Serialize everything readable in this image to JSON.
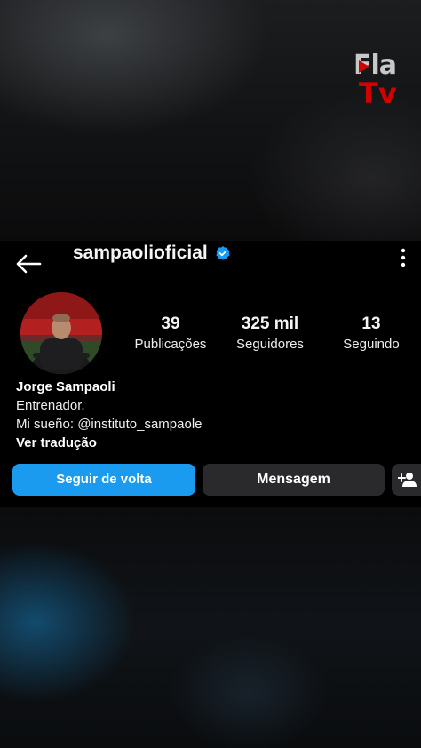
{
  "watermark": {
    "line1": "Fla",
    "line2": "Tv",
    "colors": {
      "line1": "#c8c8c8",
      "line2": "#d40000"
    }
  },
  "header": {
    "back_icon": "arrow-left-icon",
    "username": "sampaolioficial",
    "verified_icon": "verified-badge-icon",
    "more_icon": "more-vertical-icon"
  },
  "profile": {
    "avatar": "profile-photo",
    "stats": [
      {
        "value": "39",
        "label": "Publicações"
      },
      {
        "value": "325 mil",
        "label": "Seguidores"
      },
      {
        "value": "13",
        "label": "Seguindo"
      }
    ],
    "name": "Jorge Sampaoli",
    "bio_lines": [
      "Entrenador.",
      "Mi sueño: @instituto_sampaole"
    ],
    "translate_link": "Ver tradução"
  },
  "actions": {
    "follow_back_label": "Seguir de volta",
    "message_label": "Mensagem",
    "add_person_icon": "add-person-icon",
    "colors": {
      "primary": "#1a9bf0",
      "secondary": "#2a2a2c",
      "verified": "#1a9bf0"
    }
  }
}
